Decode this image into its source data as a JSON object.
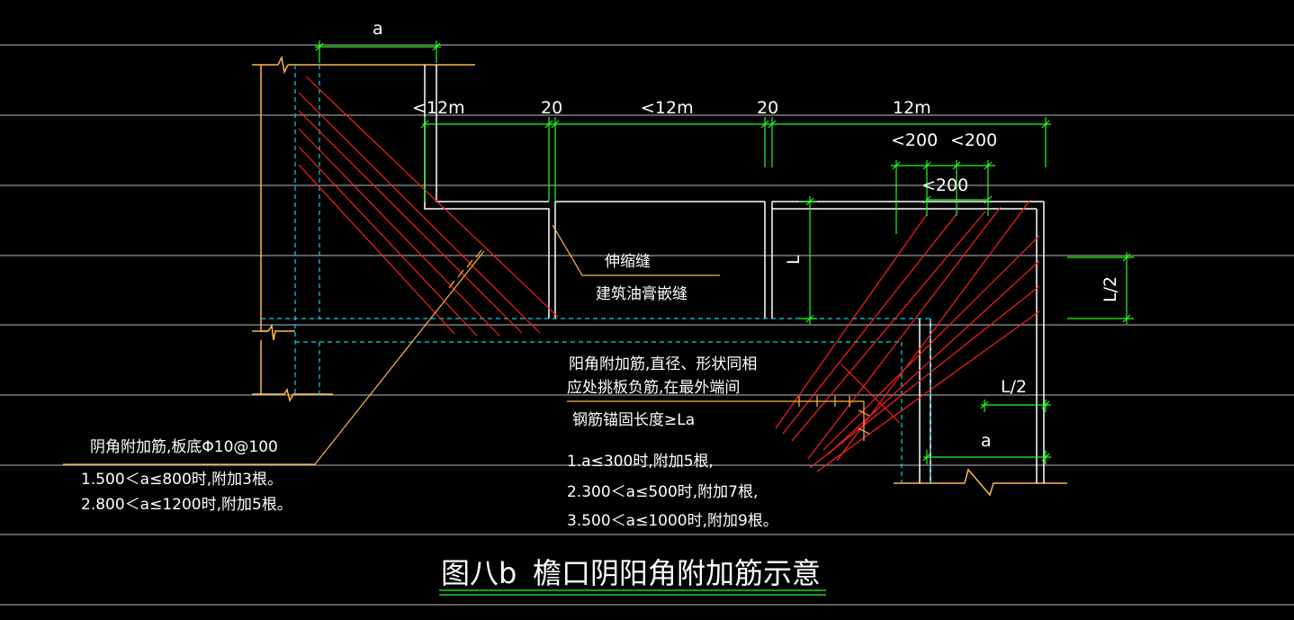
{
  "colors": {
    "background": "#000000",
    "grid": "#bdbdbd",
    "outline": "#ffffff",
    "dashed": "#00d8e8",
    "rebar": "#ff2020",
    "orange": "#ffb84a",
    "dimension": "#22ff22",
    "text": "#ffffff"
  },
  "dims": {
    "a_top": "a",
    "len1": "<12m",
    "gap1": "20",
    "len2": "<12m",
    "gap2": "20",
    "len3": "12m",
    "s1": "<200",
    "s2": "<200",
    "s3": "<200",
    "L": "L",
    "L_half_side": "L/2",
    "L_half_bottom": "L/2",
    "a_bottom": "a"
  },
  "labels": {
    "joint_1": "伸缩缝",
    "joint_2": "建筑油膏嵌缝",
    "outer_1": "阳角附加筋,直径、形状同相",
    "outer_2": "应处挑板负筋,在最外端间",
    "outer_3": "钢筋锚固长度≥La",
    "outer_rule_1": "1.a≤300时,附加5根,",
    "outer_rule_2": "2.300＜a≤500时,附加7根,",
    "outer_rule_3": "3.500＜a≤1000时,附加9根。",
    "inner_title": "阴角附加筋,板底Φ10@100",
    "inner_rule_1": "1.500＜a≤800时,附加3根。",
    "inner_rule_2": "2.800＜a≤1200时,附加5根。"
  },
  "caption": {
    "figure_no": "图八b",
    "title": "檐口阴阳角附加筋示意"
  }
}
